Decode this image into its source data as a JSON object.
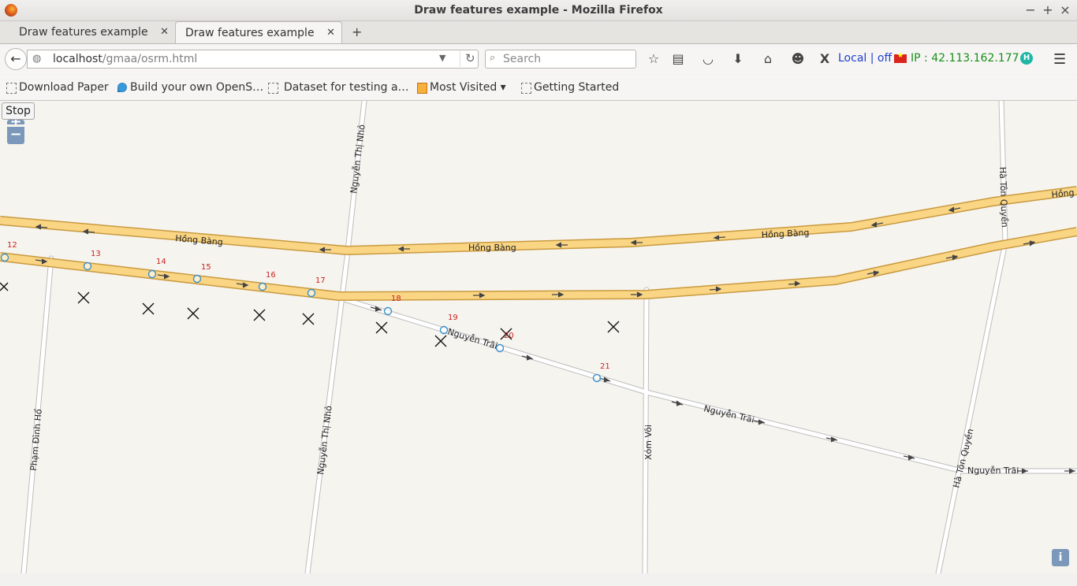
{
  "window": {
    "title": "Draw features example - Mozilla Firefox"
  },
  "tabs": [
    {
      "label": "Draw features example",
      "active": false
    },
    {
      "label": "Draw features example",
      "active": true
    }
  ],
  "navbar": {
    "url_host": "localhost",
    "url_path": "/gmaa/osrm.html",
    "search_placeholder": "Search",
    "ext_local": "Local | off",
    "ip": "IP : 42.113.162.177",
    "hbadge": "H"
  },
  "bookmarks": [
    {
      "label": "Download Paper",
      "icon": "page-icon"
    },
    {
      "label": "Build your own OpenS…",
      "icon": "drupal-icon"
    },
    {
      "label": "Dataset for testing a…",
      "icon": "page-icon"
    },
    {
      "label": "Most Visited ▾",
      "icon": "folder-icon"
    },
    {
      "label": "Getting Started",
      "icon": "page-icon"
    }
  ],
  "map": {
    "stop_label": "Stop",
    "zoom_in": "+",
    "zoom_out": "−",
    "info": "i",
    "street_labels": {
      "hong_bang": "Hồng Bàng",
      "nguyen_trai": "Nguyễn Trãi",
      "nguyen_thi_nho": "Nguyễn Thị Nhỏ",
      "pham_dinh_ho": "Phạm Đình Hổ",
      "xom_voi": "Xóm Vôi",
      "ha_ton_quyen": "Hà Tôn Quyền"
    },
    "waypoint_labels": [
      "12",
      "13",
      "14",
      "15",
      "16",
      "17",
      "18",
      "19",
      "20",
      "21"
    ],
    "colors": {
      "major_road": "#f9d584",
      "major_road_casing": "#c99a3f",
      "minor_road": "#ffffff",
      "minor_road_casing": "#bdbdbd",
      "waypoint": "#3a8fc8",
      "label": "#cc2222"
    }
  }
}
